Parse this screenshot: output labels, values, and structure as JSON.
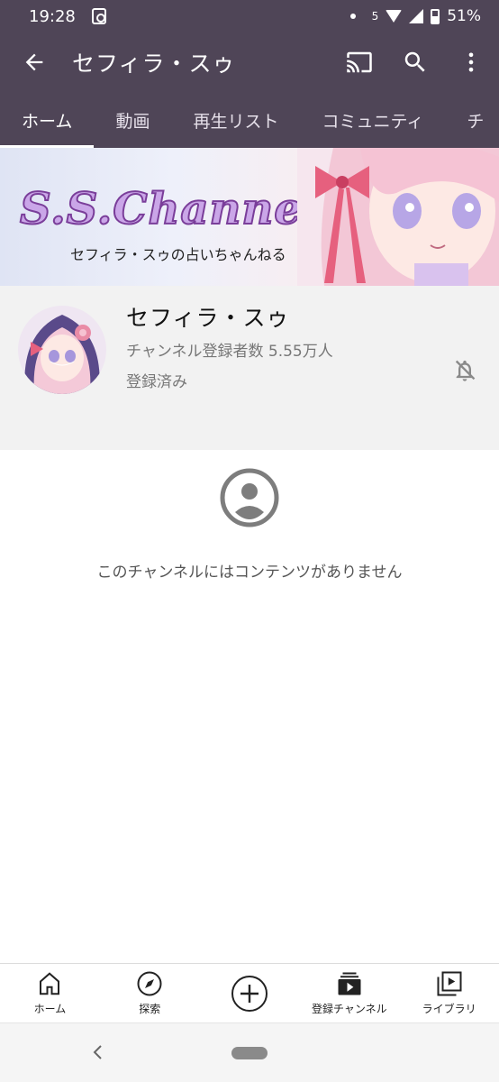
{
  "status_bar": {
    "time": "19:28",
    "battery": "51%",
    "data_indicator": "5"
  },
  "app_bar": {
    "title": "セフィラ・スゥ",
    "back_icon": "arrow-left-icon",
    "actions": [
      "cast-icon",
      "search-icon",
      "more-vert-icon"
    ]
  },
  "tabs": [
    {
      "label": "ホーム",
      "active": true
    },
    {
      "label": "動画",
      "active": false
    },
    {
      "label": "再生リスト",
      "active": false
    },
    {
      "label": "コミュニティ",
      "active": false
    },
    {
      "label": "チ",
      "active": false
    }
  ],
  "banner": {
    "logo_text": "S.S.Channel",
    "subtitle": "セフィラ・スゥの占いちゃんねる"
  },
  "channel": {
    "name": "セフィラ・スゥ",
    "subscribers": "チャンネル登録者数 5.55万人",
    "subscription_status": "登録済み",
    "bell_icon": "notifications-off-icon"
  },
  "empty_state": {
    "icon": "account-circle-icon",
    "message": "このチャンネルにはコンテンツがありません"
  },
  "bottom_nav": [
    {
      "label": "ホーム",
      "icon": "home-icon"
    },
    {
      "label": "探索",
      "icon": "explore-icon"
    },
    {
      "label": "",
      "icon": "create-icon"
    },
    {
      "label": "登録チャンネル",
      "icon": "subscriptions-icon"
    },
    {
      "label": "ライブラリ",
      "icon": "library-icon"
    }
  ],
  "colors": {
    "app_bar": "#4f4557",
    "info_bg": "#f2f2f2",
    "muted_text": "#777777"
  }
}
